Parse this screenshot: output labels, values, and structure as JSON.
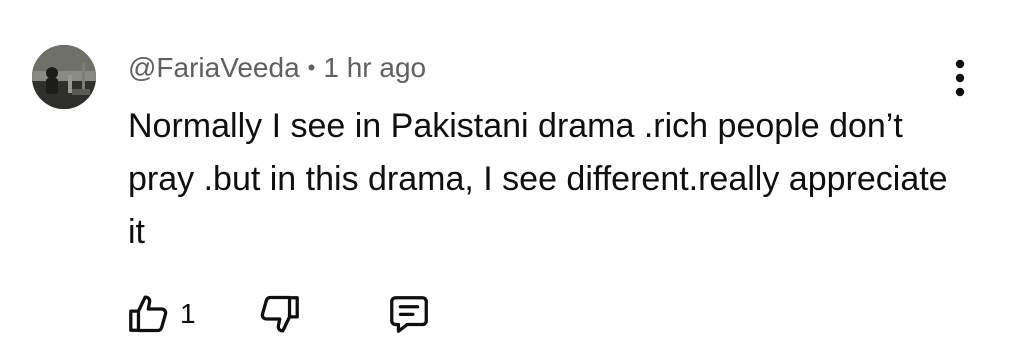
{
  "comment": {
    "author": "@FariaVeeda",
    "separator": "•",
    "time": "1 hr ago",
    "text": "Normally I see in Pakistani drama .rich people don’t pray .but in this drama, I see different.really appreciate it",
    "like_count": "1"
  },
  "icons": {
    "avatar": "user-avatar",
    "menu": "more-vert-icon",
    "like": "thumb-up-icon",
    "dislike": "thumb-down-icon",
    "reply": "reply-comment-icon"
  },
  "colors": {
    "text_primary": "#0f0f0f",
    "text_secondary": "#606060",
    "background": "#ffffff"
  }
}
